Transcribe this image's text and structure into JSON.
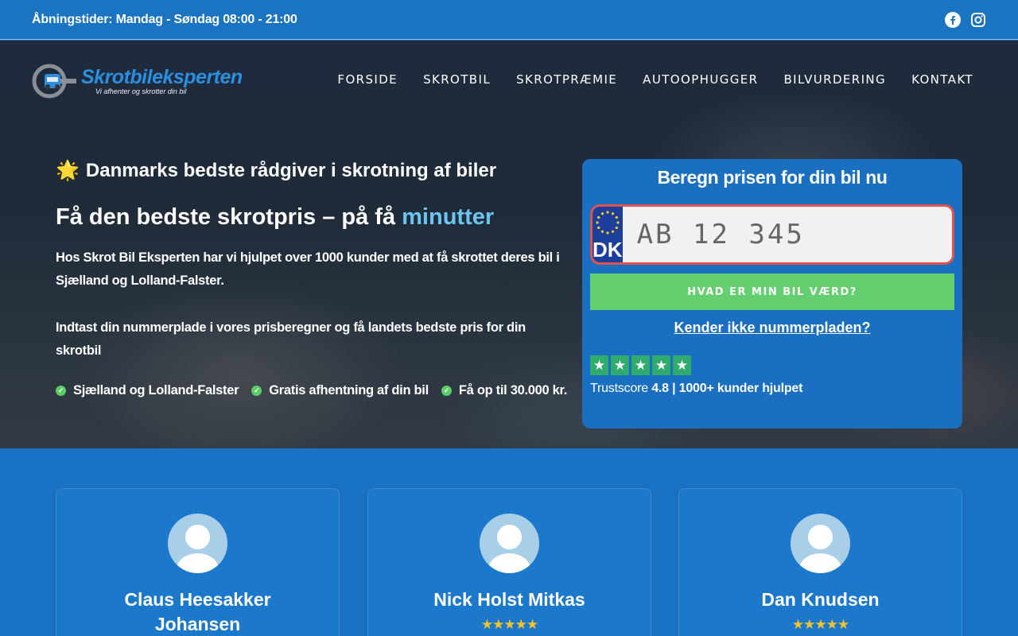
{
  "topbar": {
    "hours": "Åbningstider: Mandag - Søndag 08:00 - 21:00",
    "social": [
      "facebook-icon",
      "instagram-icon"
    ]
  },
  "logo": {
    "brand": "Skrotbileksperten",
    "tagline": "Vi afhenter og skrotter din bil"
  },
  "nav": {
    "items": [
      "FORSIDE",
      "SKROTBIL",
      "SKROTPRÆMIE",
      "AUTOOPHUGGER",
      "BILVURDERING",
      "KONTAKT"
    ]
  },
  "hero": {
    "heading_small": "Danmarks bedste rådgiver i skrotning af biler",
    "heading_main": "Få den bedste skrotpris – på få",
    "heading_accent": "minutter",
    "para1": "Hos Skrot Bil Eksperten har vi hjulpet over 1000 kunder med at få skrottet deres bil i Sjælland og Lolland-Falster.",
    "para2": "Indtast din nummerplade i vores prisberegner og få landets bedste pris for din skrotbil",
    "checks": [
      "Sjælland og Lolland-Falster",
      "Gratis afhentning af din bil",
      "Få op til 30.000 kr."
    ]
  },
  "calculator": {
    "title": "Beregn prisen for din bil nu",
    "plate_country": "DK",
    "plate_placeholder": "AB 12 345",
    "button_label": "HVAD ER MIN BIL VÆRD?",
    "link_label": "Kender ikke nummerpladen?",
    "rating_stars": 5,
    "trust_label": "Trustscore",
    "trust_value": "4.8 | 1000+ kunder hjulpet"
  },
  "colors": {
    "primary": "#1a74c2",
    "accent_text": "#6cc4f0",
    "button_green": "#63cf6e",
    "plate_border": "#e2514a",
    "trustpilot_green": "#2fab6d",
    "review_star": "#f8c42a"
  },
  "reviews": [
    {
      "name": "Claus Heesakker Johansen",
      "stars": ""
    },
    {
      "name": "Nick Holst Mitkas",
      "stars": "★★★★★"
    },
    {
      "name": "Dan Knudsen",
      "stars": "★★★★★"
    }
  ]
}
